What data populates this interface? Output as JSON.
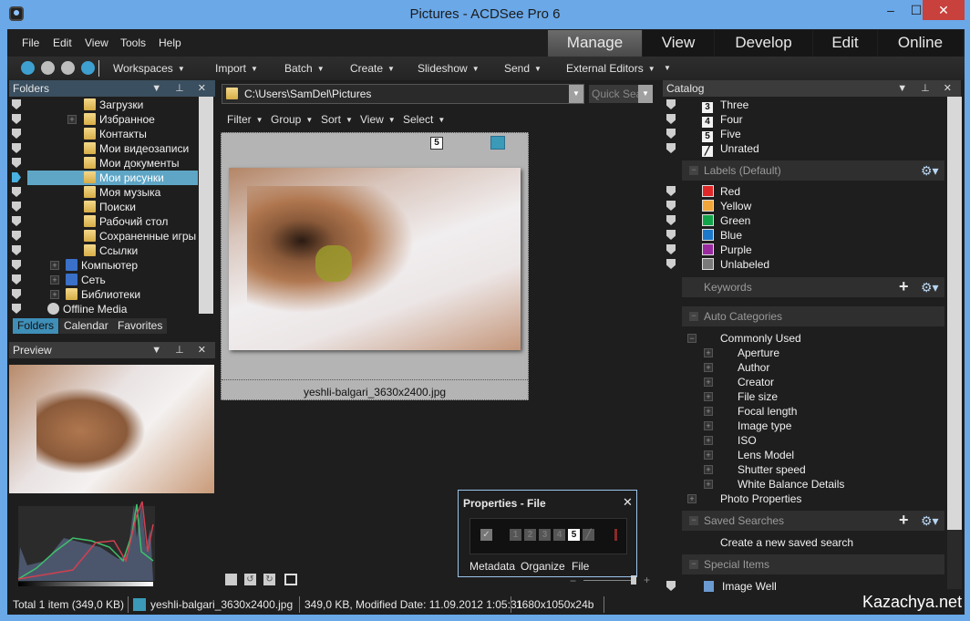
{
  "window": {
    "title": "Pictures - ACDSee Pro 6",
    "minimize": "–",
    "maximize": "☐",
    "close": "✕"
  },
  "menu": [
    "File",
    "Edit",
    "View",
    "Tools",
    "Help"
  ],
  "modes": {
    "items": [
      "Manage",
      "View",
      "Develop",
      "Edit",
      "Online"
    ],
    "active": "Manage"
  },
  "toolbar": {
    "nav_icons": [
      "home-icon",
      "back-icon",
      "forward-icon",
      "up-icon"
    ],
    "items": [
      "Workspaces",
      "Import",
      "Batch",
      "Create",
      "Slideshow",
      "Send",
      "External Editors"
    ]
  },
  "folders": {
    "title": "Folders",
    "items": [
      {
        "label": "Загрузки",
        "icon": "downloads-folder"
      },
      {
        "label": "Избранное",
        "icon": "favorites-folder",
        "expandable": true
      },
      {
        "label": "Контакты",
        "icon": "contacts-folder"
      },
      {
        "label": "Мои видеозаписи",
        "icon": "videos-folder"
      },
      {
        "label": "Мои документы",
        "icon": "documents-folder"
      },
      {
        "label": "Мои рисунки",
        "icon": "pictures-folder",
        "selected": true
      },
      {
        "label": "Моя музыка",
        "icon": "music-folder"
      },
      {
        "label": "Поиски",
        "icon": "searches-folder"
      },
      {
        "label": "Рабочий стол",
        "icon": "desktop-folder"
      },
      {
        "label": "Сохраненные игры",
        "icon": "saved-games-folder"
      },
      {
        "label": "Ссылки",
        "icon": "links-folder"
      },
      {
        "label": "Компьютер",
        "icon": "computer-icon",
        "expandable": true
      },
      {
        "label": "Сеть",
        "icon": "network-icon",
        "expandable": true
      },
      {
        "label": "Библиотеки",
        "icon": "libraries-icon",
        "expandable": true
      },
      {
        "label": "Offline Media",
        "icon": "disc-icon"
      }
    ],
    "tabs": [
      "Folders",
      "Calendar",
      "Favorites"
    ],
    "active_tab": "Folders"
  },
  "preview": {
    "title": "Preview"
  },
  "browser": {
    "path": "C:\\Users\\SamDel\\Pictures",
    "quick_search_placeholder": "Quick Search",
    "filter_items": [
      "Filter",
      "Group",
      "Sort",
      "View",
      "Select"
    ],
    "thumbnail": {
      "filename": "yeshli-balgari_3630x2400.jpg",
      "rating": "5"
    }
  },
  "properties": {
    "title": "Properties - File",
    "ratings": [
      "1",
      "2",
      "3",
      "4",
      "5"
    ],
    "selected_rating": "5",
    "tabs": [
      "Metadata",
      "Organize",
      "File"
    ],
    "active_tab": "File"
  },
  "catalog": {
    "title": "Catalog",
    "ratings": [
      {
        "num": "3",
        "label": "Three"
      },
      {
        "num": "4",
        "label": "Four"
      },
      {
        "num": "5",
        "label": "Five"
      },
      {
        "num": "",
        "label": "Unrated"
      }
    ],
    "labels_header": "Labels (Default)",
    "labels": [
      {
        "label": "Red",
        "color": "#e02828"
      },
      {
        "label": "Yellow",
        "color": "#f2a63a"
      },
      {
        "label": "Green",
        "color": "#12a44a"
      },
      {
        "label": "Blue",
        "color": "#1c78c8"
      },
      {
        "label": "Purple",
        "color": "#9a2aa0"
      },
      {
        "label": "Unlabeled",
        "color": "#7a7a7a"
      }
    ],
    "keywords_header": "Keywords",
    "auto_categories_header": "Auto Categories",
    "commonly_used": "Commonly Used",
    "auto_items": [
      "Aperture",
      "Author",
      "Creator",
      "File size",
      "Focal length",
      "Image type",
      "ISO",
      "Lens Model",
      "Shutter speed",
      "White Balance Details"
    ],
    "photo_properties": "Photo Properties",
    "saved_searches_header": "Saved Searches",
    "create_saved_search": "Create a new saved search",
    "special_items_header": "Special Items",
    "image_well": "Image Well"
  },
  "status": {
    "total": "Total 1 item  (349,0 KB)",
    "file": "yeshli-balgari_3630x2400.jpg",
    "details": "349,0 KB, Modified Date: 11.09.2012 1:05:31",
    "dimensions": "1680x1050x24b"
  },
  "watermark": "Kazachya.net"
}
